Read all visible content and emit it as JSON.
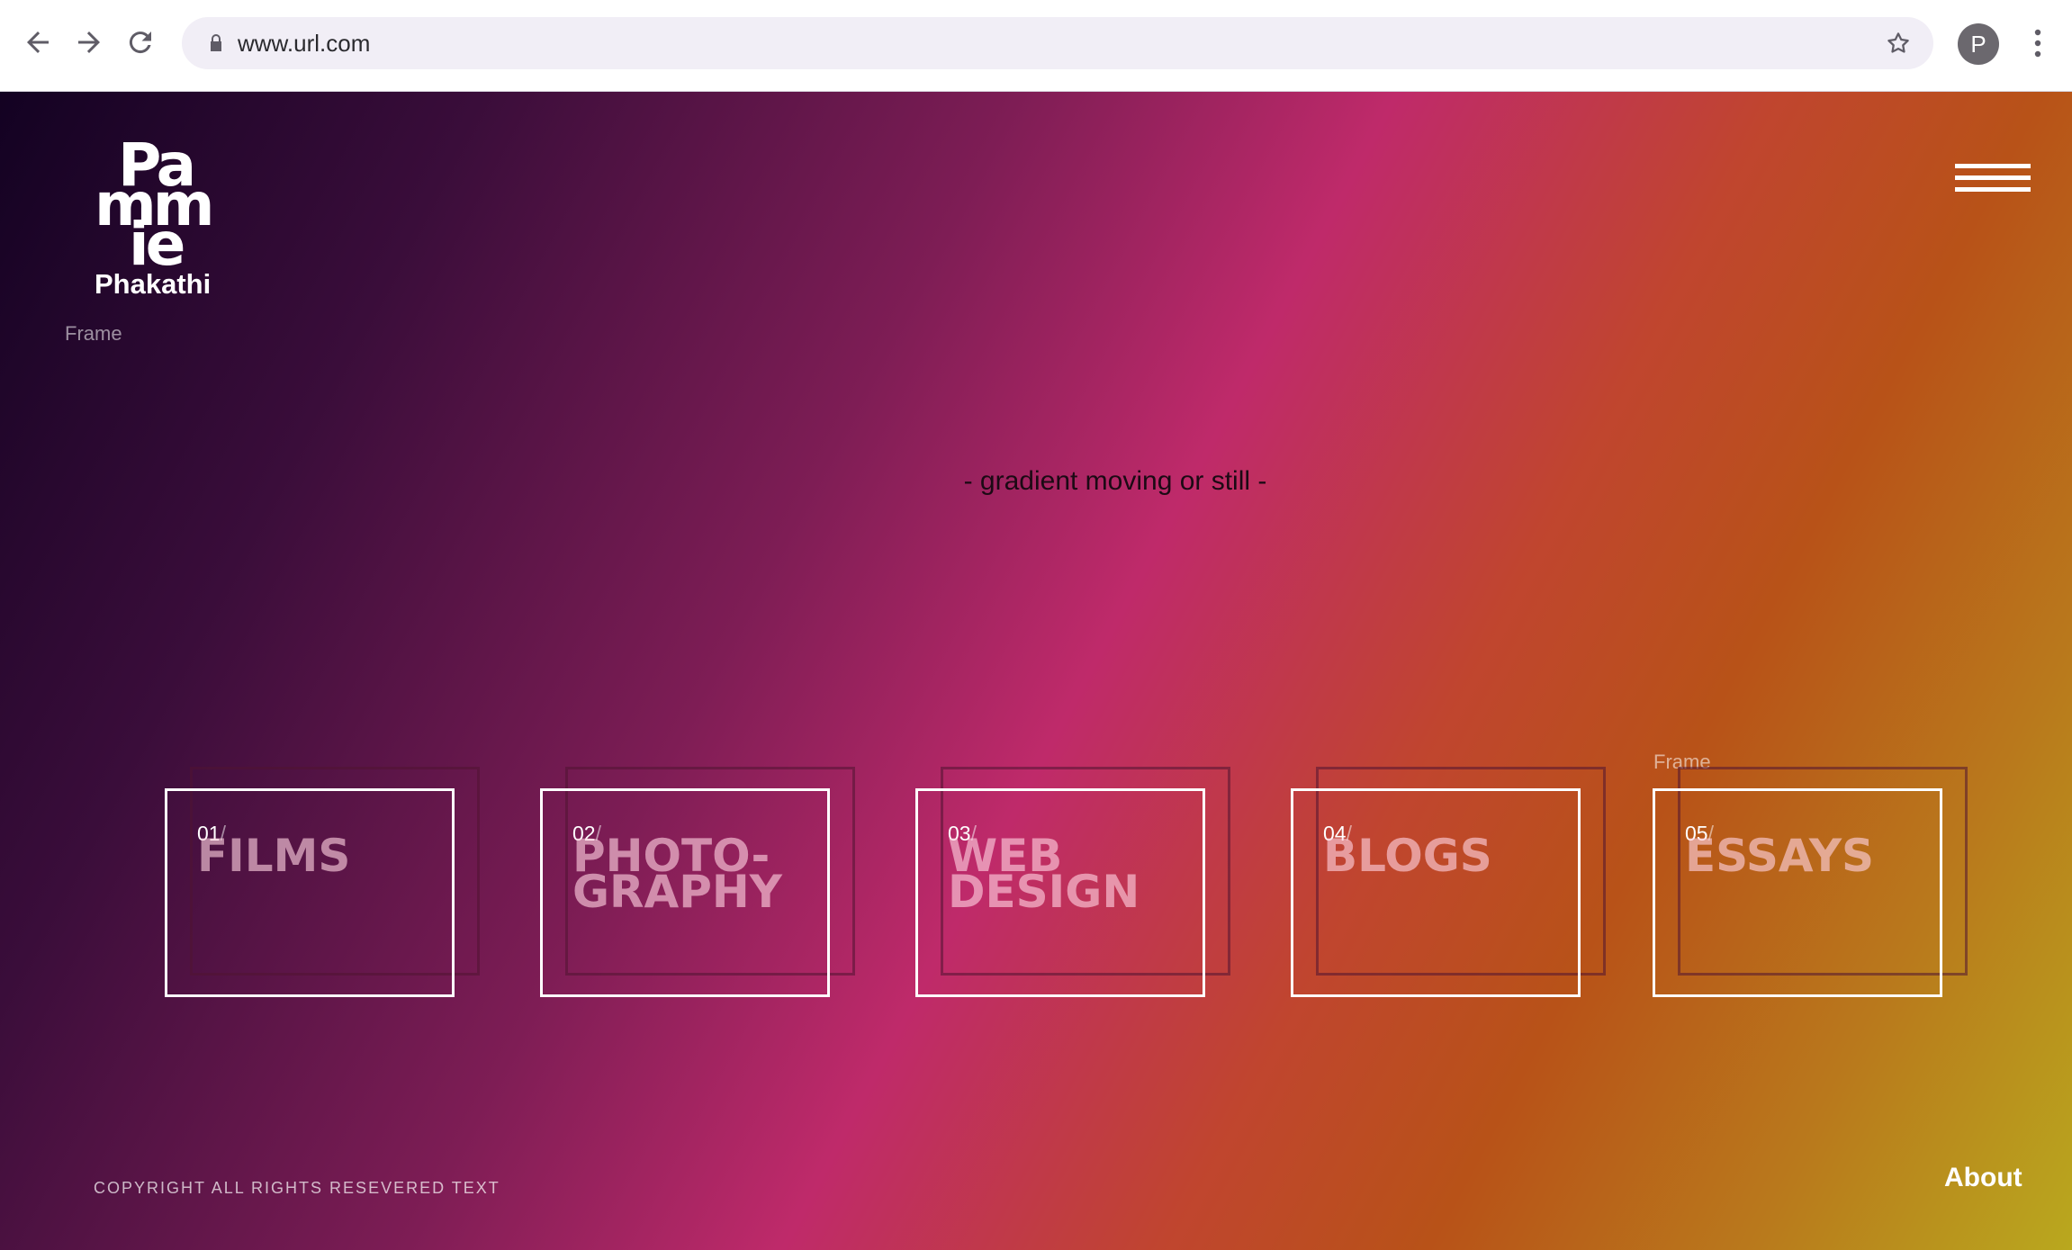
{
  "browser": {
    "url": "www.url.com",
    "profile_initial": "P"
  },
  "logo": {
    "line1": "Pa",
    "line2": "mm",
    "line3": "ie",
    "surname": "Phakathi",
    "frame_label": "Frame"
  },
  "hero": {
    "tagline": "- gradient moving or still -"
  },
  "cards": [
    {
      "number": "01",
      "slash": "/",
      "title": "FILMS"
    },
    {
      "number": "02",
      "slash": "/",
      "title": "PHOTO-\nGRAPHY"
    },
    {
      "number": "03",
      "slash": "/",
      "title": "WEB\nDESIGN"
    },
    {
      "number": "04",
      "slash": "/",
      "title": "BLOGS"
    },
    {
      "number": "05",
      "slash": "/",
      "title": "ESSAYS",
      "frame_label": "Frame"
    }
  ],
  "footer": {
    "copyright": "COPYRIGHT ALL RIGHTS RESEVERED TEXT",
    "about_label": "About"
  },
  "colors": {
    "gradient_stops": [
      "#130222",
      "#3a0d3a",
      "#7e1d55",
      "#bf2a6a",
      "#c0452f",
      "#b85218",
      "#b9791c",
      "#b9a81e"
    ],
    "text_light": "#ffffff"
  }
}
